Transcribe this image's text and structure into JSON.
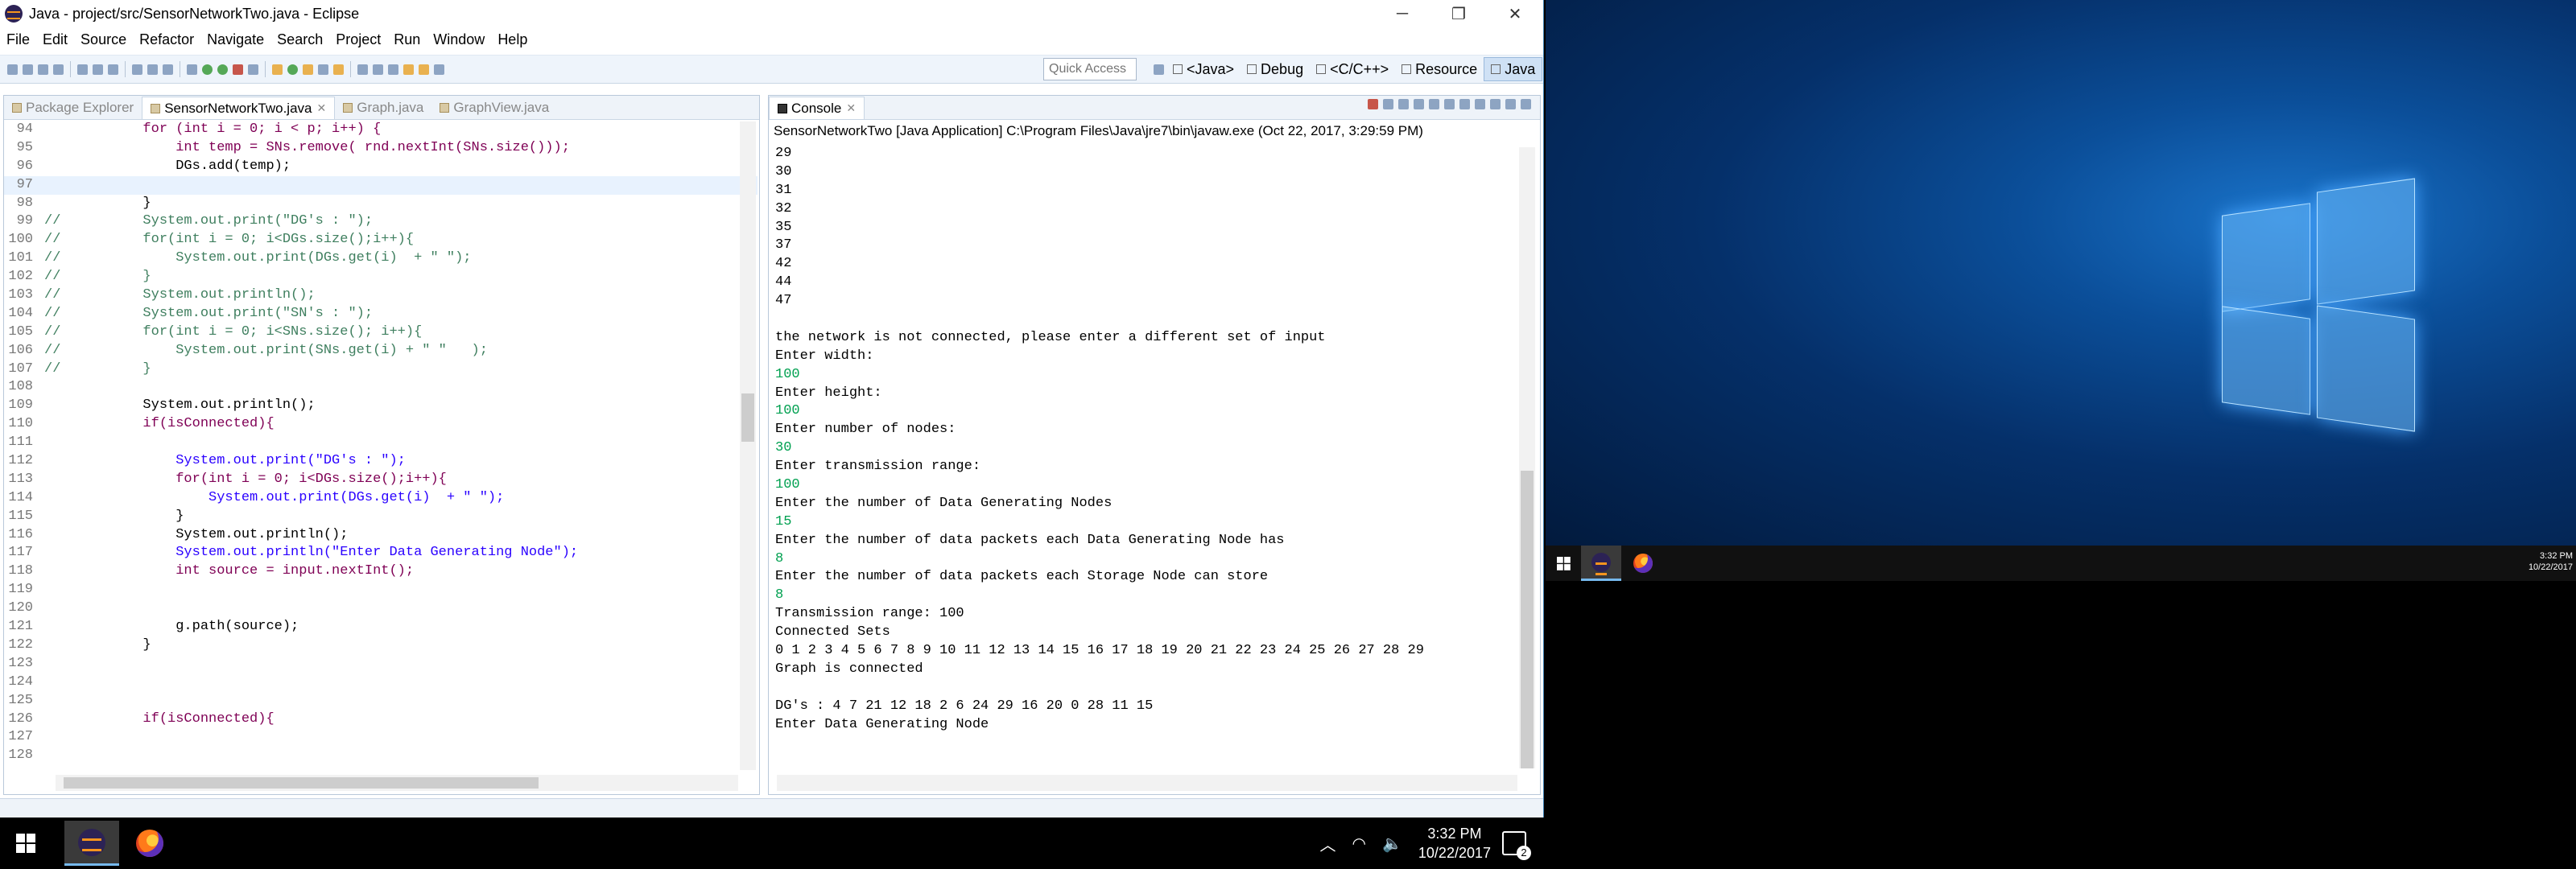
{
  "window": {
    "title": "Java - project/src/SensorNetworkTwo.java - Eclipse",
    "controls": [
      "─",
      "❐",
      "✕"
    ]
  },
  "menu": [
    "File",
    "Edit",
    "Source",
    "Refactor",
    "Navigate",
    "Search",
    "Project",
    "Run",
    "Window",
    "Help"
  ],
  "toolbar": {
    "quick_access_placeholder": "Quick Access",
    "perspectives": [
      "<Java>",
      "Debug",
      "<C/C++>",
      "Resource",
      "Java"
    ]
  },
  "editor": {
    "tabs": [
      {
        "label": "Package Explorer",
        "active": false
      },
      {
        "label": "SensorNetworkTwo.java",
        "active": true
      },
      {
        "label": "Graph.java",
        "active": false
      },
      {
        "label": "GraphView.java",
        "active": false
      }
    ],
    "lines": [
      {
        "n": "94",
        "code": "            for (int i = 0; i < p; i++) {"
      },
      {
        "n": "95",
        "code": "                int temp = SNs.remove( rnd.nextInt(SNs.size()));"
      },
      {
        "n": "96",
        "code": "                DGs.add(temp);"
      },
      {
        "n": "97",
        "code": ""
      },
      {
        "n": "98",
        "code": "            }"
      },
      {
        "n": "99",
        "code": "//          System.out.print(\"DG's : \");"
      },
      {
        "n": "100",
        "code": "//          for(int i = 0; i<DGs.size();i++){"
      },
      {
        "n": "101",
        "code": "//              System.out.print(DGs.get(i)  + \" \");"
      },
      {
        "n": "102",
        "code": "//          }"
      },
      {
        "n": "103",
        "code": "//          System.out.println();"
      },
      {
        "n": "104",
        "code": "//          System.out.print(\"SN's : \");"
      },
      {
        "n": "105",
        "code": "//          for(int i = 0; i<SNs.size(); i++){"
      },
      {
        "n": "106",
        "code": "//              System.out.print(SNs.get(i) + \" \"   );"
      },
      {
        "n": "107",
        "code": "//          }"
      },
      {
        "n": "108",
        "code": ""
      },
      {
        "n": "109",
        "code": "            System.out.println();"
      },
      {
        "n": "110",
        "code": "            if(isConnected){"
      },
      {
        "n": "111",
        "code": ""
      },
      {
        "n": "112",
        "code": "                System.out.print(\"DG's : \");"
      },
      {
        "n": "113",
        "code": "                for(int i = 0; i<DGs.size();i++){"
      },
      {
        "n": "114",
        "code": "                    System.out.print(DGs.get(i)  + \" \");"
      },
      {
        "n": "115",
        "code": "                }"
      },
      {
        "n": "116",
        "code": "                System.out.println();"
      },
      {
        "n": "117",
        "code": "                System.out.println(\"Enter Data Generating Node\");"
      },
      {
        "n": "118",
        "code": "                int source = input.nextInt();"
      },
      {
        "n": "119",
        "code": ""
      },
      {
        "n": "120",
        "code": ""
      },
      {
        "n": "121",
        "code": "                g.path(source);"
      },
      {
        "n": "122",
        "code": "            }"
      },
      {
        "n": "123",
        "code": ""
      },
      {
        "n": "124",
        "code": ""
      },
      {
        "n": "125",
        "code": ""
      },
      {
        "n": "126",
        "code": "            if(isConnected){"
      },
      {
        "n": "127",
        "code": ""
      },
      {
        "n": "128",
        "code": ""
      }
    ]
  },
  "console": {
    "tab_label": "Console",
    "header": "SensorNetworkTwo [Java Application] C:\\Program Files\\Java\\jre7\\bin\\javaw.exe (Oct 22, 2017, 3:29:59 PM)",
    "lines": [
      {
        "t": "29",
        "input": false
      },
      {
        "t": "30",
        "input": false
      },
      {
        "t": "31",
        "input": false
      },
      {
        "t": "32",
        "input": false
      },
      {
        "t": "35",
        "input": false
      },
      {
        "t": "37",
        "input": false
      },
      {
        "t": "42",
        "input": false
      },
      {
        "t": "44",
        "input": false
      },
      {
        "t": "47",
        "input": false
      },
      {
        "t": "",
        "input": false
      },
      {
        "t": "the network is not connected, please enter a different set of input",
        "input": false
      },
      {
        "t": "Enter width:",
        "input": false
      },
      {
        "t": "100",
        "input": true
      },
      {
        "t": "Enter height:",
        "input": false
      },
      {
        "t": "100",
        "input": true
      },
      {
        "t": "Enter number of nodes:",
        "input": false
      },
      {
        "t": "30",
        "input": true
      },
      {
        "t": "Enter transmission range:",
        "input": false
      },
      {
        "t": "100",
        "input": true
      },
      {
        "t": "Enter the number of Data Generating Nodes",
        "input": false
      },
      {
        "t": "15",
        "input": true
      },
      {
        "t": "Enter the number of data packets each Data Generating Node has",
        "input": false
      },
      {
        "t": "8",
        "input": true
      },
      {
        "t": "Enter the number of data packets each Storage Node can store",
        "input": false
      },
      {
        "t": "8",
        "input": true
      },
      {
        "t": "Transmission range: 100",
        "input": false
      },
      {
        "t": "Connected Sets",
        "input": false
      },
      {
        "t": "0 1 2 3 4 5 6 7 8 9 10 11 12 13 14 15 16 17 18 19 20 21 22 23 24 25 26 27 28 29",
        "input": false
      },
      {
        "t": "Graph is connected",
        "input": false
      },
      {
        "t": "",
        "input": false
      },
      {
        "t": "DG's : 4 7 21 12 18 2 6 24 29 16 20 0 28 11 15",
        "input": false
      },
      {
        "t": "Enter Data Generating Node",
        "input": false
      }
    ]
  },
  "taskbar": {
    "time": "3:32 PM",
    "date": "10/22/2017",
    "notification_count": "2",
    "apps": [
      "eclipse-icon",
      "firefox-icon"
    ]
  },
  "second_monitor": {
    "time": "3:32 PM",
    "date": "10/22/2017"
  },
  "colors": {
    "keyword": "#7f0055",
    "comment": "#3f7f5f",
    "string": "#2a00ff",
    "console_input": "#00a050",
    "accent": "#3c7fb1"
  }
}
